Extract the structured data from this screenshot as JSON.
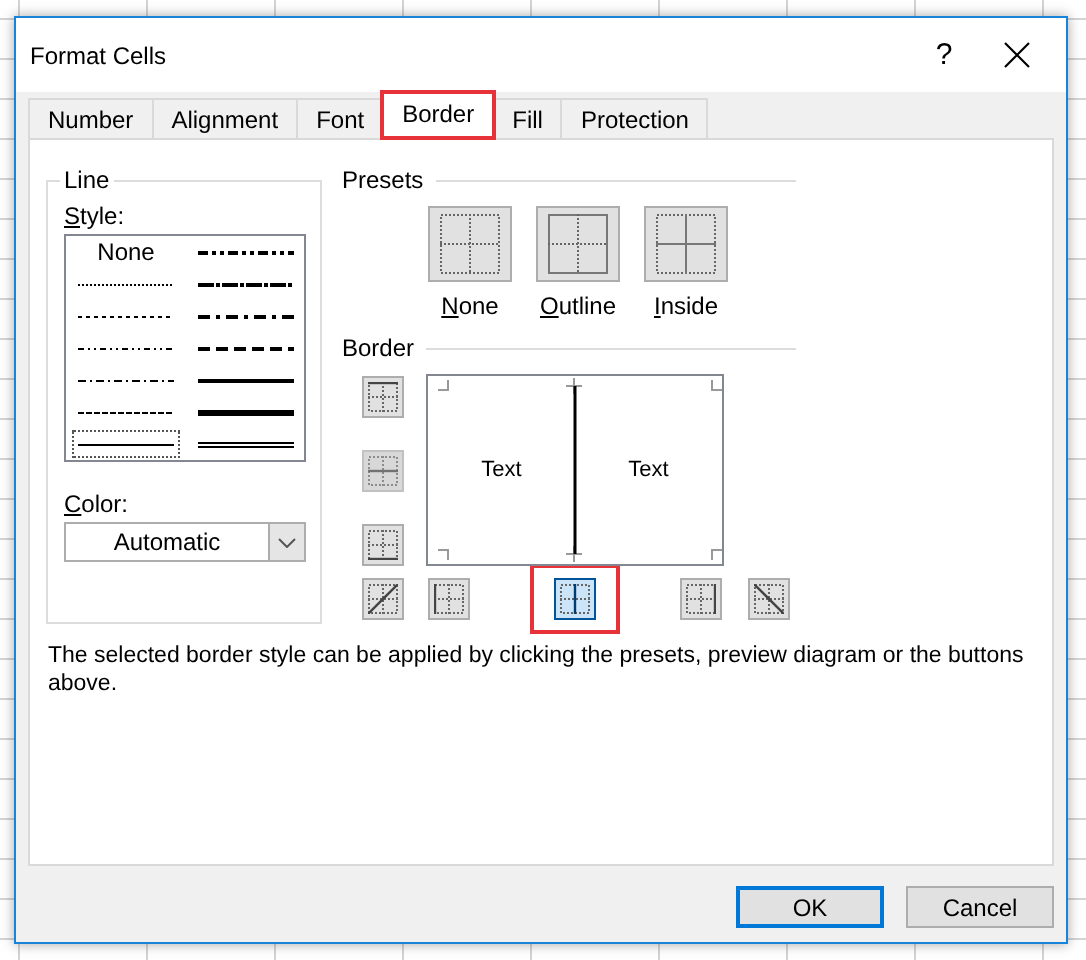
{
  "window": {
    "title": "Format Cells",
    "help_button": "?"
  },
  "tabs": [
    {
      "label": "Number",
      "selected": false,
      "highlighted": false
    },
    {
      "label": "Alignment",
      "selected": false,
      "highlighted": false
    },
    {
      "label": "Font",
      "selected": false,
      "highlighted": false
    },
    {
      "label": "Border",
      "selected": true,
      "highlighted": true
    },
    {
      "label": "Fill",
      "selected": false,
      "highlighted": false
    },
    {
      "label": "Protection",
      "selected": false,
      "highlighted": false
    }
  ],
  "line": {
    "title": "Line",
    "style_label": "Style:",
    "style_columns": [
      [
        {
          "kind": "none",
          "label": "None",
          "selected": false
        },
        {
          "kind": "hair",
          "selected": false
        },
        {
          "kind": "dotted",
          "selected": false
        },
        {
          "kind": "dash_dot_dot",
          "selected": false
        },
        {
          "kind": "dash_dot",
          "selected": false
        },
        {
          "kind": "dashed",
          "selected": false
        },
        {
          "kind": "thin",
          "selected": true
        }
      ],
      [
        {
          "kind": "medium_dash_dot_dot",
          "selected": false
        },
        {
          "kind": "slanted_dash_dot",
          "selected": false
        },
        {
          "kind": "medium_dash_dot",
          "selected": false
        },
        {
          "kind": "medium_dashed",
          "selected": false
        },
        {
          "kind": "medium",
          "selected": false
        },
        {
          "kind": "thick",
          "selected": false
        },
        {
          "kind": "double",
          "selected": false
        }
      ]
    ],
    "color_label": "Color:",
    "color": {
      "value": "Automatic"
    }
  },
  "presets": {
    "title": "Presets",
    "items": [
      {
        "kind": "none",
        "label": "None"
      },
      {
        "kind": "outline",
        "label": "Outline"
      },
      {
        "kind": "inside",
        "label": "Inside"
      }
    ]
  },
  "border": {
    "title": "Border",
    "preview_texts": [
      "Text",
      "Text"
    ],
    "buttons": [
      {
        "kind": "top",
        "pressed": false,
        "disabled": false,
        "highlighted": false
      },
      {
        "kind": "middle_h",
        "pressed": false,
        "disabled": true,
        "highlighted": false
      },
      {
        "kind": "bottom",
        "pressed": false,
        "disabled": false,
        "highlighted": false
      },
      {
        "kind": "diagonal_up",
        "pressed": false,
        "disabled": false,
        "highlighted": false
      },
      {
        "kind": "left",
        "pressed": false,
        "disabled": false,
        "highlighted": false
      },
      {
        "kind": "middle_v",
        "pressed": true,
        "disabled": false,
        "highlighted": true
      },
      {
        "kind": "right",
        "pressed": false,
        "disabled": false,
        "highlighted": false
      },
      {
        "kind": "diagonal_down",
        "pressed": false,
        "disabled": false,
        "highlighted": false
      }
    ]
  },
  "description": "The selected border style can be applied by clicking the presets, preview diagram or the buttons above.",
  "buttons": [
    {
      "label": "OK",
      "default": true
    },
    {
      "label": "Cancel",
      "default": false
    }
  ]
}
